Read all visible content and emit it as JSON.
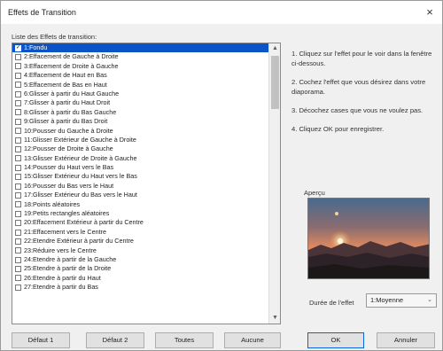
{
  "window": {
    "title": "Effets de Transition",
    "close_glyph": "×"
  },
  "list": {
    "label": "Liste des Effets de transition:",
    "items": [
      {
        "label": "1:Fondu",
        "checked": true,
        "selected": true
      },
      {
        "label": "2:Effacement de Gauche à Droite",
        "checked": false
      },
      {
        "label": "3:Effacement de Droite à Gauche",
        "checked": false
      },
      {
        "label": "4:Effacement de Haut en Bas",
        "checked": false
      },
      {
        "label": "5:Effacement de Bas en Haut",
        "checked": false
      },
      {
        "label": "6:Glisser à partir du Haut Gauche",
        "checked": false
      },
      {
        "label": "7:Glisser à partir du Haut Droit",
        "checked": false
      },
      {
        "label": "8:Glisser à partir du Bas Gauche",
        "checked": false
      },
      {
        "label": "9:Glisser à partir du Bas Droit",
        "checked": false
      },
      {
        "label": "10:Pousser du Gauche à Droite",
        "checked": false
      },
      {
        "label": "11:Glisser Extérieur de Gauche à Droite",
        "checked": false
      },
      {
        "label": "12:Pousser de Droite à Gauche",
        "checked": false
      },
      {
        "label": "13:Glisser Extérieur de Droite à Gauche",
        "checked": false
      },
      {
        "label": "14:Pousser du Haut vers le Bas",
        "checked": false
      },
      {
        "label": "15:Glisser Extérieur du Haut vers le Bas",
        "checked": false
      },
      {
        "label": "16:Pousser du Bas vers le Haut",
        "checked": false
      },
      {
        "label": "17:Glisser Extérieur du Bas vers le Haut",
        "checked": false
      },
      {
        "label": "18:Points aléatoires",
        "checked": false
      },
      {
        "label": "19:Petits rectangles aléatoires",
        "checked": false
      },
      {
        "label": "20:Effacement Extérieur à partir du Centre",
        "checked": false
      },
      {
        "label": "21:Effacement vers le Centre",
        "checked": false
      },
      {
        "label": "22:Etendre Extérieur à partir du Centre",
        "checked": false
      },
      {
        "label": "23:Réduire vers le Centre",
        "checked": false
      },
      {
        "label": "24:Etendre à partir de la Gauche",
        "checked": false
      },
      {
        "label": "25:Etendre à partir de la Droite",
        "checked": false
      },
      {
        "label": "26:Etendre à partir du Haut",
        "checked": false
      },
      {
        "label": "27:Etendre à partir du Bas",
        "checked": false
      }
    ],
    "scroll_up_glyph": "▲",
    "scroll_down_glyph": "▼"
  },
  "instructions": [
    "1. Cliquez sur l'effet pour le voir dans la fenêtre ci-dessous.",
    "2. Cochez l'effet que vous désirez dans votre diaporama.",
    "3. Décochez cases que vous ne voulez pas.",
    "4. Cliquez OK pour enregistrer."
  ],
  "preview": {
    "label": "Aperçu"
  },
  "duration": {
    "label": "Durée de l'effet",
    "value": "1:Moyenne",
    "chevron_glyph": "⌄"
  },
  "buttons": {
    "default1": "Défaut 1",
    "default2": "Défaut 2",
    "all": "Toutes",
    "none": "Aucune",
    "ok": "OK",
    "cancel": "Annuler"
  },
  "icons": [
    "close-icon",
    "checkbox-icon",
    "scroll-up-icon",
    "scroll-down-icon",
    "chevron-down-icon"
  ]
}
